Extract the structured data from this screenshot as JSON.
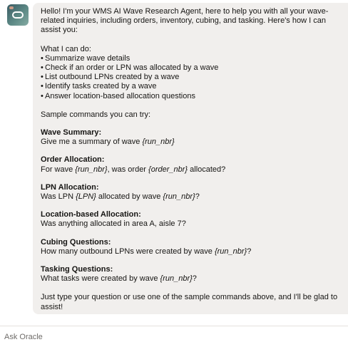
{
  "agent": {
    "avatar_icon": "oracle-digital-assistant-icon"
  },
  "message": {
    "intro": "Hello! I'm your WMS AI Wave Research Agent, here to help you with all your wave-related inquiries, including orders, inventory, cubing, and tasking. Here's how I can assist you:",
    "capabilities_heading": "What I can do:",
    "capabilities": [
      "Summarize wave details",
      "Check if an order or LPN was allocated by a wave",
      "List outbound LPNs created by a wave",
      "Identify tasks created by a wave",
      "Answer location-based allocation questions"
    ],
    "samples_heading": "Sample commands you can try:",
    "sections": [
      {
        "title": "Wave Summary:",
        "parts": [
          {
            "text": "Give me a summary of wave ",
            "italic": false
          },
          {
            "text": "{run_nbr}",
            "italic": true
          }
        ]
      },
      {
        "title": "Order Allocation:",
        "parts": [
          {
            "text": "For wave ",
            "italic": false
          },
          {
            "text": "{run_nbr}",
            "italic": true
          },
          {
            "text": ", was order ",
            "italic": false
          },
          {
            "text": "{order_nbr}",
            "italic": true
          },
          {
            "text": " allocated?",
            "italic": false
          }
        ]
      },
      {
        "title": "LPN Allocation:",
        "parts": [
          {
            "text": "Was LPN ",
            "italic": false
          },
          {
            "text": "{LPN}",
            "italic": true
          },
          {
            "text": " allocated by wave ",
            "italic": false
          },
          {
            "text": "{run_nbr}",
            "italic": true
          },
          {
            "text": "?",
            "italic": false
          }
        ]
      },
      {
        "title": "Location-based Allocation:",
        "parts": [
          {
            "text": "Was anything allocated in area A, aisle 7?",
            "italic": false
          }
        ]
      },
      {
        "title": "Cubing Questions:",
        "parts": [
          {
            "text": "How many outbound LPNs were created by wave ",
            "italic": false
          },
          {
            "text": "{run_nbr}",
            "italic": true
          },
          {
            "text": "?",
            "italic": false
          }
        ]
      },
      {
        "title": "Tasking Questions:",
        "parts": [
          {
            "text": "What tasks were created by wave ",
            "italic": false
          },
          {
            "text": "{run_nbr}",
            "italic": true
          },
          {
            "text": "?",
            "italic": false
          }
        ]
      }
    ],
    "closing": "Just type your question or use one of the sample commands above, and I'll be glad to assist!"
  },
  "composer": {
    "placeholder": "Ask Oracle",
    "value": ""
  },
  "colors": {
    "bubble_background": "#f1efed",
    "text": "#161513",
    "placeholder": "#6f6c69"
  }
}
